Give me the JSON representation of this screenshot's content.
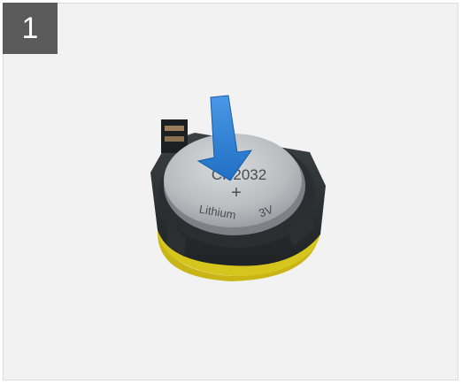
{
  "step": {
    "number": "1"
  },
  "battery": {
    "model": "CR2032",
    "polarity": "+",
    "chemistry": "Lithium",
    "voltage": "3V"
  },
  "colors": {
    "badge": "#5a5a5a",
    "arrow": "#2f7fd6",
    "holder": "#2f3336",
    "pcb": "#d2c21a",
    "coin": "#b8bbbe"
  },
  "icons": {
    "arrow": "press-down-arrow-icon"
  }
}
